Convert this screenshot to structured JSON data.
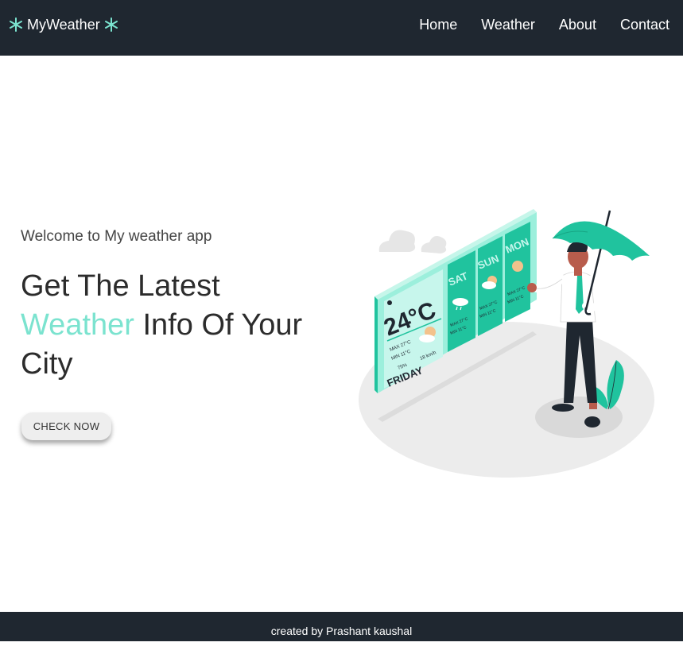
{
  "navbar": {
    "brand": "MyWeather",
    "links": [
      "Home",
      "Weather",
      "About",
      "Contact"
    ]
  },
  "hero": {
    "welcome": "Welcome to My weather app",
    "headline_start": "Get The Latest",
    "headline_accent": "Weather",
    "headline_end": "Info Of Your City",
    "cta_label": "CHECK NOW"
  },
  "illustration": {
    "today_temp": "24°C",
    "today_max": "MAX  27°C",
    "today_min": "MIN  11°C",
    "today_humidity": "75%",
    "today_wind": "18 km/h",
    "today_day": "FRIDAY",
    "day2": "SAT",
    "day3": "SUN",
    "day4": "MON",
    "day_max": "MAX 27°C",
    "day_min": "MIN 11°C"
  },
  "footer": {
    "text": "created by Prashant kaushal"
  },
  "colors": {
    "nav_bg": "#1f2730",
    "accent": "#7be3cf",
    "teal": "#20c39e"
  }
}
